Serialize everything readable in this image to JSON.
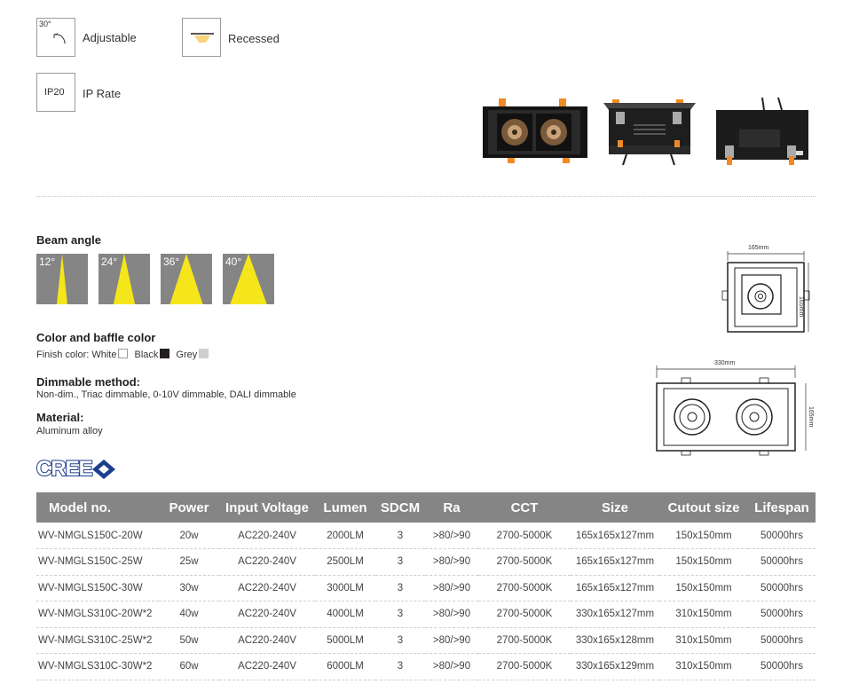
{
  "features": {
    "adjustable": {
      "angle": "30°",
      "label": "Adjustable",
      "icon": "adjustable-tilt-icon"
    },
    "recessed": {
      "label": "Recessed",
      "icon": "recessed-light-icon"
    },
    "ip": {
      "code": "IP20",
      "label": "IP Rate"
    }
  },
  "beam": {
    "title": "Beam angle",
    "angles": [
      "12°",
      "24°",
      "36°",
      "40°"
    ],
    "colors": {
      "tile": "#858585",
      "beam": "#f5e61b"
    }
  },
  "color_section": {
    "title": "Color and baffle color",
    "finish_label": "Finish color:",
    "options": [
      {
        "name": "White",
        "color": "#ffffff"
      },
      {
        "name": "Black",
        "color": "#231f20"
      },
      {
        "name": "Grey",
        "color": "#cfcfcf"
      }
    ]
  },
  "dimmable": {
    "title": "Dimmable method:",
    "text": "Non-dim., Triac dimmable, 0-10V dimmable, DALI dimmable"
  },
  "material": {
    "title": "Material:",
    "text": "Aluminum alloy"
  },
  "brand": {
    "logo": "CREE",
    "color": "#1b3e8f"
  },
  "drawings": {
    "single": {
      "width": "165mm",
      "height": "165mm"
    },
    "double": {
      "width": "330mm",
      "height": "165mm"
    }
  },
  "table": {
    "headers": [
      "Model no.",
      "Power",
      "Input Voltage",
      "Lumen",
      "SDCM",
      "Ra",
      "CCT",
      "Size",
      "Cutout size",
      "Lifespan"
    ],
    "rows": [
      [
        "WV-NMGLS150C-20W",
        "20w",
        "AC220-240V",
        "2000LM",
        "3",
        ">80/>90",
        "2700-5000K",
        "165x165x127mm",
        "150x150mm",
        "50000hrs"
      ],
      [
        "WV-NMGLS150C-25W",
        "25w",
        "AC220-240V",
        "2500LM",
        "3",
        ">80/>90",
        "2700-5000K",
        "165x165x127mm",
        "150x150mm",
        "50000hrs"
      ],
      [
        "WV-NMGLS150C-30W",
        "30w",
        "AC220-240V",
        "3000LM",
        "3",
        ">80/>90",
        "2700-5000K",
        "165x165x127mm",
        "150x150mm",
        "50000hrs"
      ],
      [
        "WV-NMGLS310C-20W*2",
        "40w",
        "AC220-240V",
        "4000LM",
        "3",
        ">80/>90",
        "2700-5000K",
        "330x165x127mm",
        "310x150mm",
        "50000hrs"
      ],
      [
        "WV-NMGLS310C-25W*2",
        "50w",
        "AC220-240V",
        "5000LM",
        "3",
        ">80/>90",
        "2700-5000K",
        "330x165x128mm",
        "310x150mm",
        "50000hrs"
      ],
      [
        "WV-NMGLS310C-30W*2",
        "60w",
        "AC220-240V",
        "6000LM",
        "3",
        ">80/>90",
        "2700-5000K",
        "330x165x129mm",
        "310x150mm",
        "50000hrs"
      ]
    ]
  }
}
